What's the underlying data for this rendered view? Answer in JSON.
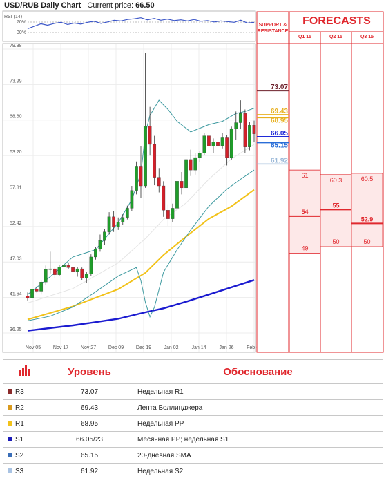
{
  "header": {
    "title": "USD/RUB Daily Chart",
    "price_label": "Current price:",
    "price_value": "66.50"
  },
  "rsi": {
    "label": "RSI (14)",
    "levels": [
      "70%",
      "30%"
    ],
    "values": [
      48,
      55,
      62,
      58,
      63,
      66,
      60,
      64,
      61,
      66,
      69,
      63,
      67,
      72,
      70,
      74,
      76,
      79,
      73,
      77,
      72,
      75,
      71,
      73,
      70,
      74,
      69,
      71,
      67,
      70,
      68,
      66,
      72,
      64,
      66
    ]
  },
  "chart_data": {
    "type": "candlestick",
    "title": "USD/RUB Daily Chart",
    "y_ticks": [
      "79.38",
      "73.99",
      "68.60",
      "63.20",
      "57.81",
      "52.42",
      "47.03",
      "41.64",
      "36.25"
    ],
    "x_ticks": [
      "Nov 05",
      "Nov 17",
      "Nov 27",
      "Dec 09",
      "Dec 19",
      "Jan 02",
      "Jan 14",
      "Jan 26",
      "Feb 05"
    ],
    "ylim": [
      36.25,
      79.38
    ],
    "grid": true,
    "colors": {
      "up": "#1f9d2a",
      "down": "#d2202a",
      "sma": "#e6e6e6"
    },
    "candles": [
      [
        41.9,
        42.4,
        41.2,
        41.6
      ],
      [
        41.6,
        43.1,
        41.3,
        42.9
      ],
      [
        42.9,
        43.3,
        42.4,
        42.6
      ],
      [
        42.6,
        44.2,
        42.1,
        44.0
      ],
      [
        44.0,
        46.5,
        43.6,
        45.9
      ],
      [
        45.9,
        48.6,
        45.3,
        46.0
      ],
      [
        46.0,
        46.3,
        44.6,
        45.1
      ],
      [
        45.1,
        46.6,
        44.9,
        46.3
      ],
      [
        46.3,
        47.1,
        45.6,
        46.5
      ],
      [
        46.5,
        46.9,
        46.0,
        46.2
      ],
      [
        46.2,
        46.6,
        45.2,
        45.6
      ],
      [
        45.6,
        46.3,
        44.8,
        46.0
      ],
      [
        46.0,
        46.2,
        44.3,
        44.6
      ],
      [
        44.6,
        45.5,
        43.9,
        45.2
      ],
      [
        45.2,
        48.2,
        44.9,
        47.8
      ],
      [
        47.8,
        49.3,
        47.4,
        49.0
      ],
      [
        49.0,
        51.2,
        48.6,
        50.3
      ],
      [
        50.3,
        52.1,
        49.6,
        51.6
      ],
      [
        51.6,
        54.6,
        51.2,
        53.9
      ],
      [
        53.9,
        54.8,
        51.6,
        52.4
      ],
      [
        52.4,
        53.8,
        51.9,
        53.1
      ],
      [
        53.1,
        54.3,
        52.7,
        53.8
      ],
      [
        53.8,
        55.6,
        53.5,
        55.2
      ],
      [
        55.2,
        58.6,
        54.8,
        57.9
      ],
      [
        57.9,
        62.3,
        57.3,
        61.6
      ],
      [
        61.6,
        64.6,
        56.8,
        58.6
      ],
      [
        58.6,
        78.8,
        58.3,
        67.7
      ],
      [
        67.7,
        70.6,
        63.2,
        64.9
      ],
      [
        64.9,
        66.2,
        58.7,
        59.9
      ],
      [
        59.9,
        61.3,
        57.6,
        58.6
      ],
      [
        58.6,
        59.3,
        53.9,
        54.9
      ],
      [
        54.9,
        55.8,
        52.5,
        53.6
      ],
      [
        53.6,
        55.9,
        53.1,
        55.2
      ],
      [
        55.2,
        59.8,
        54.8,
        59.3
      ],
      [
        59.3,
        60.7,
        57.3,
        58.3
      ],
      [
        58.3,
        63.6,
        58.0,
        62.6
      ],
      [
        62.6,
        64.1,
        60.1,
        61.0
      ],
      [
        61.0,
        63.6,
        60.3,
        62.9
      ],
      [
        62.9,
        63.9,
        62.2,
        63.6
      ],
      [
        63.6,
        66.6,
        63.3,
        66.2
      ],
      [
        66.2,
        66.9,
        63.9,
        64.6
      ],
      [
        64.6,
        65.8,
        63.6,
        65.3
      ],
      [
        65.3,
        66.3,
        64.2,
        64.7
      ],
      [
        64.7,
        66.6,
        64.3,
        65.9
      ],
      [
        65.9,
        66.3,
        61.7,
        62.9
      ],
      [
        62.9,
        67.6,
        62.6,
        67.3
      ],
      [
        67.3,
        69.9,
        65.6,
        68.2
      ],
      [
        68.2,
        71.6,
        67.2,
        69.6
      ],
      [
        69.6,
        70.2,
        63.6,
        64.5
      ],
      [
        64.5,
        68.3,
        64.0,
        67.8
      ],
      [
        67.8,
        68.5,
        65.3,
        66.5
      ]
    ],
    "boll_upper": [
      [
        0,
        42.1
      ],
      [
        5,
        44.8
      ],
      [
        10,
        47.8
      ],
      [
        15,
        48.9
      ],
      [
        20,
        53.0
      ],
      [
        23,
        56.5
      ],
      [
        25,
        60.5
      ],
      [
        26,
        66.6
      ],
      [
        27,
        69.3
      ],
      [
        29,
        71.6
      ],
      [
        31,
        70.2
      ],
      [
        33,
        68.4
      ],
      [
        36,
        66.8
      ],
      [
        40,
        67.9
      ],
      [
        43,
        68.4
      ],
      [
        46,
        69.6
      ],
      [
        48,
        69.9
      ],
      [
        50,
        70.4
      ]
    ],
    "boll_lower": [
      [
        0,
        38.1
      ],
      [
        5,
        38.8
      ],
      [
        10,
        40.2
      ],
      [
        15,
        42.5
      ],
      [
        20,
        44.9
      ],
      [
        24,
        46.2
      ],
      [
        25,
        44.2
      ],
      [
        26,
        40.9
      ],
      [
        27,
        38.7
      ],
      [
        28,
        40.2
      ],
      [
        30,
        45.5
      ],
      [
        33,
        48.9
      ],
      [
        36,
        51.9
      ],
      [
        40,
        55.5
      ],
      [
        44,
        58.1
      ],
      [
        47,
        59.6
      ],
      [
        50,
        61.0
      ]
    ],
    "sma20": [
      [
        0,
        40.8
      ],
      [
        10,
        43.0
      ],
      [
        20,
        46.9
      ],
      [
        26,
        50.6
      ],
      [
        30,
        53.5
      ],
      [
        35,
        56.0
      ],
      [
        40,
        59.6
      ],
      [
        45,
        62.7
      ],
      [
        50,
        64.9
      ]
    ],
    "ma_mid": [
      [
        0,
        38.3
      ],
      [
        10,
        40.3
      ],
      [
        20,
        42.9
      ],
      [
        26,
        45.4
      ],
      [
        30,
        48.1
      ],
      [
        35,
        50.9
      ],
      [
        40,
        53.6
      ],
      [
        45,
        55.5
      ],
      [
        50,
        58.0
      ]
    ],
    "ma_long": [
      [
        0,
        36.6
      ],
      [
        10,
        37.4
      ],
      [
        20,
        38.4
      ],
      [
        26,
        39.4
      ],
      [
        30,
        40.0
      ],
      [
        35,
        41.0
      ],
      [
        40,
        42.1
      ],
      [
        45,
        43.2
      ],
      [
        50,
        44.3
      ]
    ],
    "levels": [
      {
        "value": "73.07",
        "color": "#6b1f2a"
      },
      {
        "value": "69.43",
        "color": "#e8b020"
      },
      {
        "value": "68.95",
        "color": "#e8b020"
      },
      {
        "value": "66.05",
        "color": "#1f2ad8"
      },
      {
        "value": "65.15",
        "color": "#2a6ed8"
      },
      {
        "value": "61.92",
        "color": "#9ab8d8"
      }
    ]
  },
  "forecasts": {
    "title": "FORECASTS",
    "support_label": "SUPPORT & RESISTANCE",
    "quarters": [
      {
        "label": "Q1 15",
        "high": "61",
        "mid": "54",
        "low": "49"
      },
      {
        "label": "Q2 15",
        "high": "60.3",
        "mid": "55",
        "low": "50"
      },
      {
        "label": "Q3 15",
        "high": "60.5",
        "mid": "52.9",
        "low": "50"
      }
    ]
  },
  "table": {
    "col_level": "Уровень",
    "col_reason": "Обоснование",
    "rows": [
      {
        "name": "R3",
        "value": "73.07",
        "reason": "Недельная R1",
        "color": "#8b2a2a"
      },
      {
        "name": "R2",
        "value": "69.43",
        "reason": "Лента Боллинджера",
        "color": "#d99a1e"
      },
      {
        "name": "R1",
        "value": "68.95",
        "reason": "Недельная PP",
        "color": "#f2c21a"
      },
      {
        "name": "S1",
        "value": "66.05/23",
        "reason": "Месячная PP; недельная S1",
        "color": "#1b1bb8"
      },
      {
        "name": "S2",
        "value": "65.15",
        "reason": "20-дневная SMA",
        "color": "#3a6eb8"
      },
      {
        "name": "S3",
        "value": "61.92",
        "reason": "Недельная S2",
        "color": "#a9c3e3"
      }
    ]
  }
}
